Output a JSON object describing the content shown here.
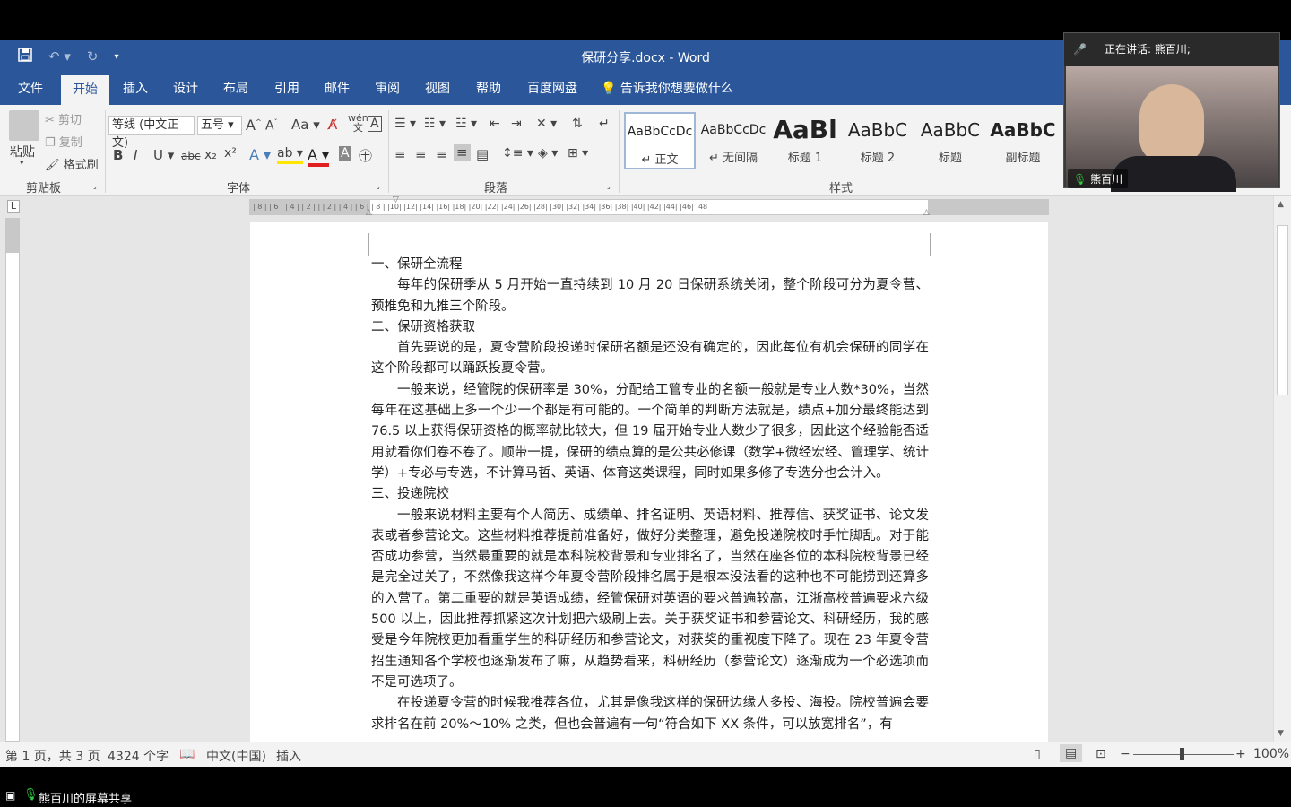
{
  "window": {
    "title": "保研分享.docx  -  Word"
  },
  "tabs": [
    "文件",
    "开始",
    "插入",
    "设计",
    "布局",
    "引用",
    "邮件",
    "审阅",
    "视图",
    "帮助",
    "百度网盘"
  ],
  "tell_me": "告诉我你想要做什么",
  "clipboard": {
    "paste": "粘贴",
    "cut": "剪切",
    "copy": "复制",
    "format_painter": "格式刷",
    "label": "剪贴板"
  },
  "font": {
    "name": "等线 (中文正文)",
    "size": "五号",
    "label": "字体",
    "wen": "wén"
  },
  "paragraph": {
    "label": "段落"
  },
  "styles": {
    "label": "样式",
    "items": [
      {
        "sample": "AaBbCcDc",
        "name": "↵ 正文"
      },
      {
        "sample": "AaBbCcDc",
        "name": "↵ 无间隔"
      },
      {
        "sample": "AaBl",
        "name": "标题 1"
      },
      {
        "sample": "AaBbC",
        "name": "标题 2"
      },
      {
        "sample": "AaBbC",
        "name": "标题"
      },
      {
        "sample": "AaBbC",
        "name": "副标题"
      }
    ]
  },
  "ruler_labels": "| 8 |   | 6 |   | 4 |   | 2 |   |   | 2 |   | 4 |   | 6 |   | 8 |   |10|   |12|   |14|   |16|   |18|   |20|   |22|   |24|   |26|   |28|   |30|   |32|   |34|   |36|   |38|   |40|   |42|   |44|   |46|   |48",
  "document": {
    "paragraphs": [
      {
        "indent": false,
        "text": "一、保研全流程"
      },
      {
        "indent": true,
        "text": "每年的保研季从 5 月开始一直持续到 10 月 20 日保研系统关闭，整个阶段可分为夏令营、预推免和九推三个阶段。"
      },
      {
        "indent": false,
        "text": "二、保研资格获取"
      },
      {
        "indent": true,
        "text": "首先要说的是，夏令营阶段投递时保研名额是还没有确定的，因此每位有机会保研的同学在这个阶段都可以踊跃投夏令营。"
      },
      {
        "indent": true,
        "text": "一般来说，经管院的保研率是 30%，分配给工管专业的名额一般就是专业人数*30%，当然每年在这基础上多一个少一个都是有可能的。一个简单的判断方法就是，绩点+加分最终能达到 76.5 以上获得保研资格的概率就比较大，但 19 届开始专业人数少了很多，因此这个经验能否适用就看你们卷不卷了。顺带一提，保研的绩点算的是公共必修课（数学+微经宏经、管理学、统计学）+专必与专选，不计算马哲、英语、体育这类课程，同时如果多修了专选分也会计入。"
      },
      {
        "indent": false,
        "text": "三、投递院校"
      },
      {
        "indent": true,
        "text": "一般来说材料主要有个人简历、成绩单、排名证明、英语材料、推荐信、获奖证书、论文发表或者参营论文。这些材料推荐提前准备好，做好分类整理，避免投递院校时手忙脚乱。对于能否成功参营，当然最重要的就是本科院校背景和专业排名了，当然在座各位的本科院校背景已经是完全过关了，不然像我这样今年夏令营阶段排名属于是根本没法看的这种也不可能捞到还算多的入营了。第二重要的就是英语成绩，经管保研对英语的要求普遍较高，江浙高校普遍要求六级 500 以上，因此推荐抓紧这次计划把六级刷上去。关于获奖证书和参营论文、科研经历，我的感受是今年院校更加看重学生的科研经历和参营论文，对获奖的重视度下降了。现在 23 年夏令营招生通知各个学校也逐渐发布了嘛，从趋势看来，科研经历（参营论文）逐渐成为一个必选项而不是可选项了。"
      },
      {
        "indent": true,
        "text": "在投递夏令营的时候我推荐各位，尤其是像我这样的保研边缘人多投、海投。院校普遍会要求排名在前 20%～10% 之类，但也会普遍有一句“符合如下 XX 条件，可以放宽排名”，有"
      }
    ]
  },
  "status": {
    "page": "第 1 页，共 3 页",
    "words": "4324 个字",
    "lang": "中文(中国)",
    "mode": "插入",
    "zoom": "100%"
  },
  "meeting": {
    "speaking": "正在讲话: 熊百川;",
    "participant": "熊百川",
    "share_label": "熊百川的屏幕共享"
  },
  "colors": {
    "word_blue": "#2b579a",
    "ribbon_bg": "#f3f3f3",
    "doc_bg": "#e6e6e6"
  }
}
